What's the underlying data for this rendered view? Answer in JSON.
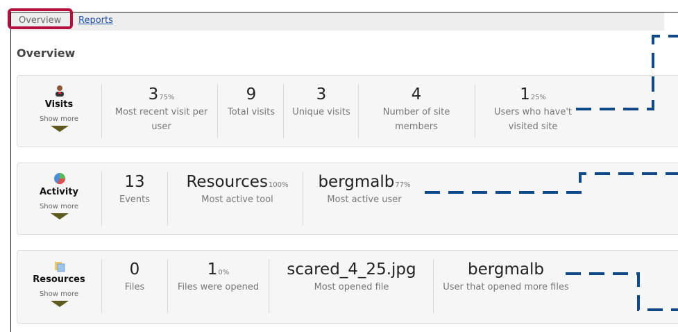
{
  "tabs": {
    "overview": "Overview",
    "reports": "Reports"
  },
  "page_title": "Overview",
  "visits": {
    "name": "Visits",
    "show_more": "Show more",
    "stats": [
      {
        "value": "3",
        "sup": "75%",
        "label": "Most recent visit per user"
      },
      {
        "value": "9",
        "sup": "",
        "label": "Total visits"
      },
      {
        "value": "3",
        "sup": "",
        "label": "Unique visits"
      },
      {
        "value": "4",
        "sup": "",
        "label": "Number of site members"
      },
      {
        "value": "1",
        "sup": "25%",
        "label": "Users who have't visited site"
      }
    ]
  },
  "activity": {
    "name": "Activity",
    "show_more": "Show more",
    "stats": [
      {
        "value": "13",
        "sup": "",
        "label": "Events"
      },
      {
        "value": "Resources",
        "sup": "100%",
        "label": "Most active tool"
      },
      {
        "value": "bergmalb",
        "sup": "77%",
        "label": "Most active user"
      }
    ]
  },
  "resources": {
    "name": "Resources",
    "show_more": "Show more",
    "stats": [
      {
        "value": "0",
        "sup": "",
        "label": "Files"
      },
      {
        "value": "1",
        "sup": "0%",
        "label": "Files were opened"
      },
      {
        "value": "scared_4_25.jpg",
        "sup": "",
        "label": "Most opened file"
      },
      {
        "value": "bergmalb",
        "sup": "",
        "label": "User that opened more files"
      }
    ]
  },
  "colors": {
    "highlight": "#b5103c",
    "callout": "#0f4a86",
    "link": "#1f4fa8"
  }
}
